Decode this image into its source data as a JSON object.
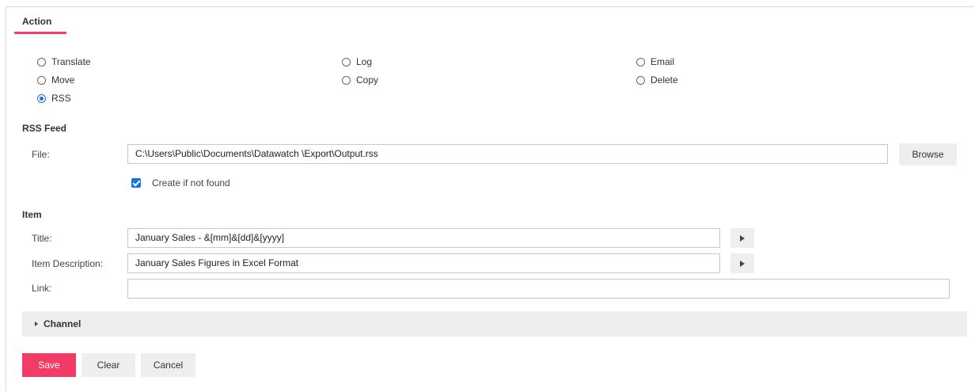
{
  "tab": {
    "title": "Action"
  },
  "actions": {
    "translate": "Translate",
    "move": "Move",
    "rss": "RSS",
    "log": "Log",
    "copy": "Copy",
    "email": "Email",
    "delete": "Delete",
    "selected": "RSS"
  },
  "rss_feed": {
    "heading": "RSS Feed",
    "file_label": "File:",
    "file_value": "C:\\Users\\Public\\Documents\\Datawatch \\Export\\Output.rss",
    "browse_label": "Browse",
    "create_label": "Create if not found",
    "create_checked": true
  },
  "item": {
    "heading": "Item",
    "title_label": "Title:",
    "title_value": "January Sales - &[mm]&[dd]&[yyyy]",
    "description_label": "Item Description:",
    "description_value": "January Sales Figures in Excel Format",
    "link_label": "Link:",
    "link_value": ""
  },
  "channel": {
    "label": "Channel"
  },
  "footer": {
    "save_label": "Save",
    "clear_label": "Clear",
    "cancel_label": "Cancel"
  },
  "colors": {
    "accent": "#f23c66",
    "checkbox": "#1a73e8",
    "button_grey": "#eeeeee"
  }
}
